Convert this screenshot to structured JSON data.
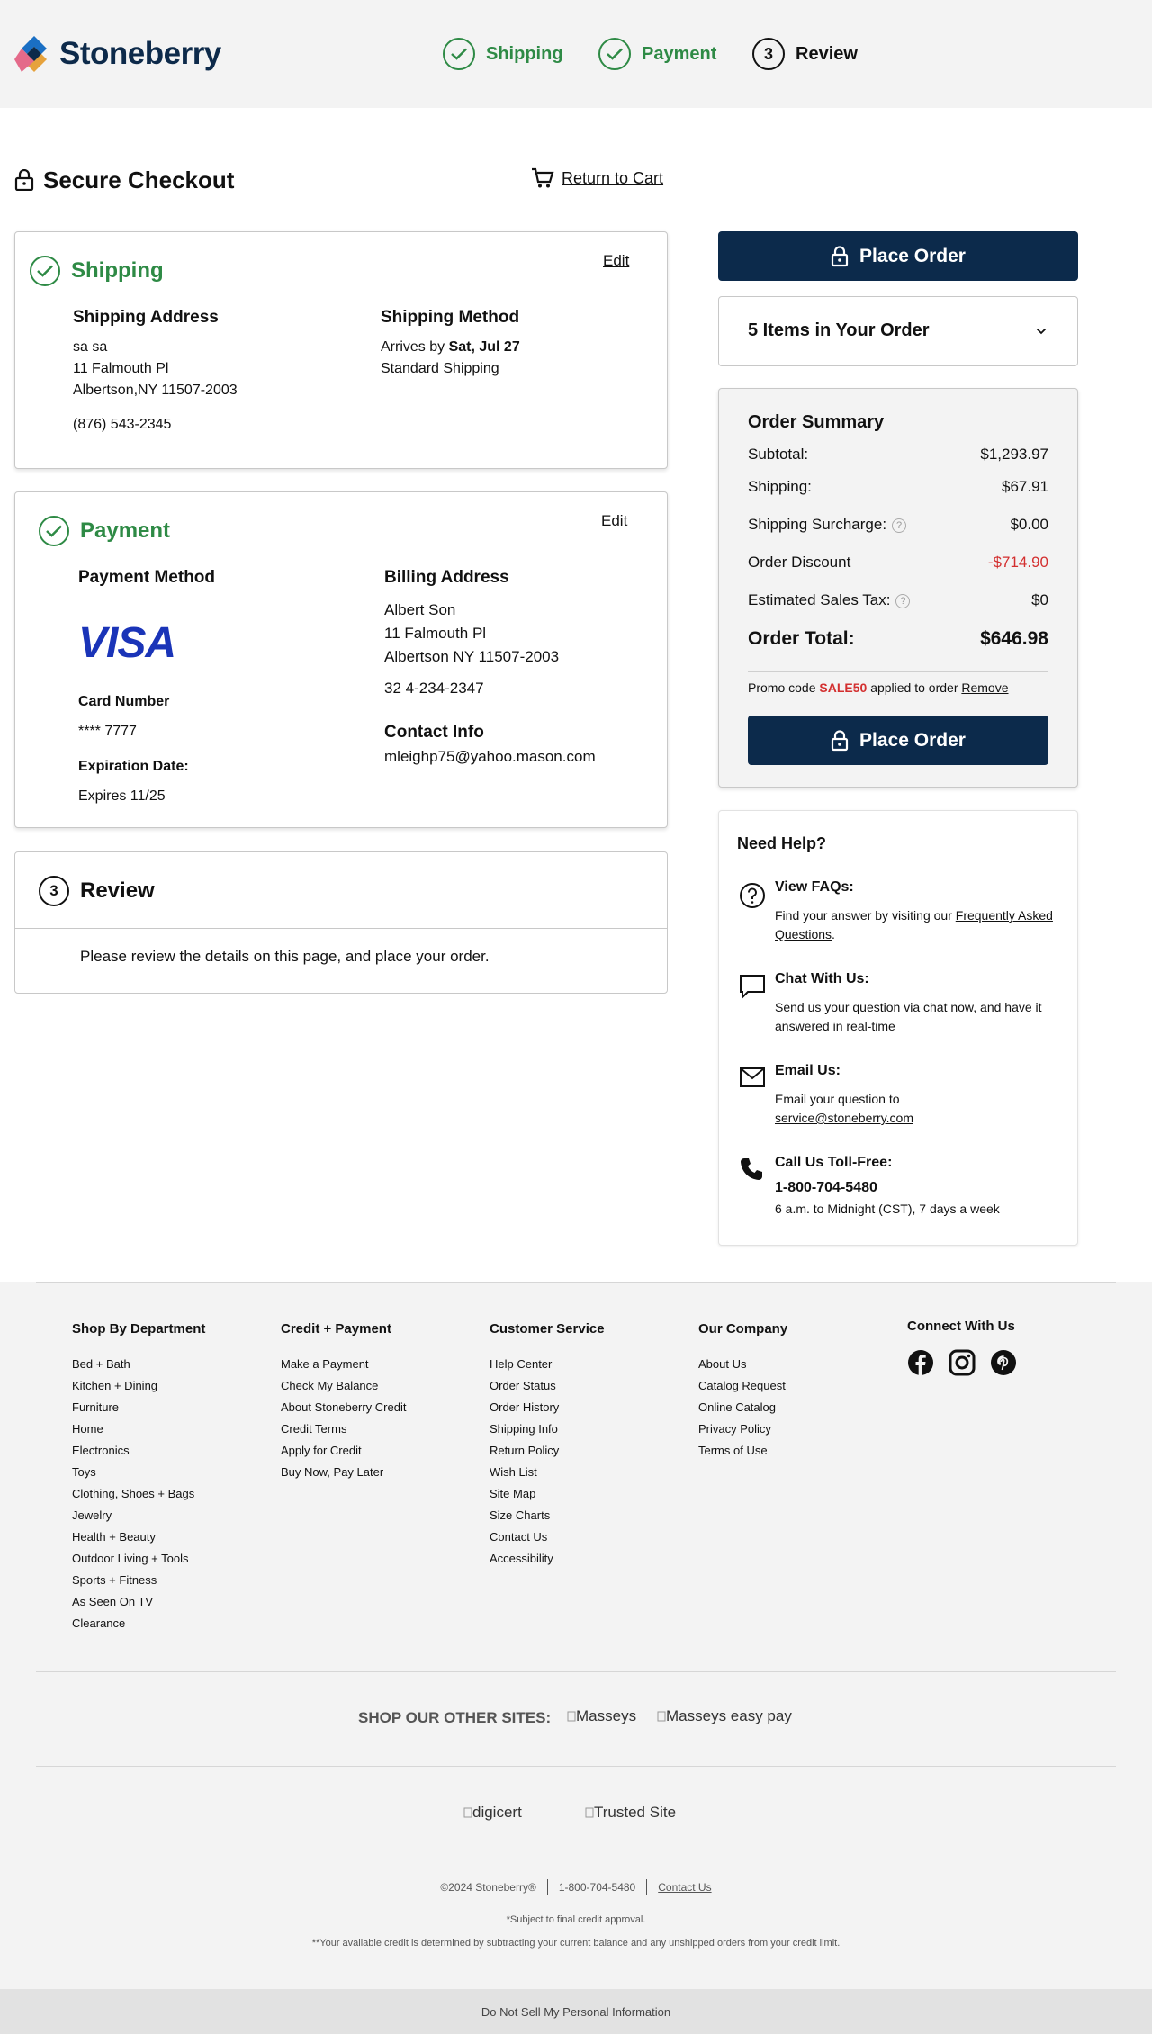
{
  "header": {
    "logo_text": "Stoneberry",
    "steps": [
      {
        "label": "Shipping",
        "state": "complete"
      },
      {
        "label": "Payment",
        "state": "complete"
      },
      {
        "label": "Review",
        "number": "3",
        "state": "current"
      }
    ]
  },
  "checkout": {
    "title": "Secure Checkout",
    "return_to_cart": "Return to Cart"
  },
  "shipping": {
    "heading": "Shipping",
    "edit": "Edit",
    "address_label": "Shipping Address",
    "address_lines": [
      "sa sa",
      "11 Falmouth Pl",
      "Albertson,NY 11507-2003"
    ],
    "phone": "(876) 543-2345",
    "method_label": "Shipping Method",
    "arrives_prefix": "Arrives by",
    "arrives_date": "Sat, Jul 27",
    "method": "Standard Shipping"
  },
  "payment": {
    "heading": "Payment",
    "edit": "Edit",
    "method_label": "Payment Method",
    "card_brand": "VISA",
    "card_number_label": "Card Number",
    "card_number": "**** 7777",
    "expiration_label": "Expiration Date:",
    "expiration": "Expires 11/25",
    "billing_label": "Billing Address",
    "billing_lines": [
      "Albert Son",
      "11 Falmouth Pl",
      "Albertson NY 11507-2003"
    ],
    "billing_phone": "32 4-234-2347",
    "contact_label": "Contact Info",
    "contact_email": "mleighp75@yahoo.mason.com"
  },
  "review": {
    "number": "3",
    "heading": "Review",
    "message": "Please review the details on this page, and place your order."
  },
  "order": {
    "place_order": "Place Order",
    "items_summary": "5 Items in Your Order",
    "summary_title": "Order Summary",
    "rows": [
      {
        "label": "Subtotal:",
        "value": "$1,293.97"
      },
      {
        "label": "Shipping:",
        "value": "$67.91"
      },
      {
        "label": "Shipping Surcharge:",
        "value": "$0.00",
        "help": "?"
      },
      {
        "label": "Order Discount",
        "value": "-$714.90"
      },
      {
        "label": "Estimated Sales Tax:",
        "value": "$0",
        "help": "?"
      }
    ],
    "total_label": "Order Total:",
    "total_value": "$646.98",
    "promo_prefix": "Promo code",
    "promo_code": "SALE50",
    "promo_suffix": "applied to order",
    "promo_remove": "Remove",
    "discount_color": "#d32f2f",
    "brand_navy": "#0c2a4b"
  },
  "help": {
    "title": "Need Help?",
    "faq_title": "View FAQs:",
    "faq_text": "Find your answer by visiting our",
    "faq_link": "Frequently Asked Questions",
    "faq_end": ".",
    "chat_title": "Chat With Us:",
    "chat_text": "Send us your question via",
    "chat_link": "chat now",
    "chat_end": ", and have it answered in real-time",
    "email_title": "Email Us:",
    "email_text": "Email your question to",
    "email_link": "service@stoneberry.com",
    "call_title": "Call Us Toll-Free:",
    "call_number": "1-800-704-5480",
    "call_hours": "6 a.m. to Midnight (CST), 7 days a week"
  },
  "footer": {
    "columns": [
      {
        "title": "Shop By Department",
        "links": [
          "Bed + Bath",
          "Kitchen + Dining",
          "Furniture",
          "Home",
          "Electronics",
          "Toys",
          "Clothing, Shoes + Bags",
          "Jewelry",
          "Health + Beauty",
          "Outdoor Living + Tools",
          "Sports + Fitness",
          "As Seen On TV",
          "Clearance"
        ]
      },
      {
        "title": "Credit + Payment",
        "links": [
          "Make a Payment",
          "Check My Balance",
          "About Stoneberry Credit",
          "Credit Terms",
          "Apply for Credit",
          "Buy Now, Pay Later"
        ]
      },
      {
        "title": "Customer Service",
        "links": [
          "Help Center",
          "Order Status",
          "Order History",
          "Shipping Info",
          "Return Policy",
          "Wish List",
          "Site Map",
          "Size Charts",
          "Contact Us",
          "Accessibility"
        ]
      },
      {
        "title": "Our Company",
        "links": [
          "About Us",
          "Catalog Request",
          "Online Catalog",
          "Privacy Policy",
          "Terms of Use"
        ]
      }
    ],
    "connect_title": "Connect With Us",
    "social": [
      "facebook-icon",
      "instagram-icon",
      "pinterest-icon"
    ],
    "other_sites_label": "SHOP OUR OTHER SITES:",
    "other_sites": [
      "Masseys",
      "Masseys easy pay"
    ],
    "trust": [
      "digicert",
      "Trusted Site"
    ],
    "copyright": "©2024 Stoneberry®",
    "phone": "1-800-704-5480",
    "contact": "Contact Us",
    "note1": "*Subject to final credit approval.",
    "note2": "**Your available credit is determined by subtracting your current balance and any unshipped orders from your credit limit.",
    "do_not_sell": "Do Not Sell My Personal Information"
  }
}
